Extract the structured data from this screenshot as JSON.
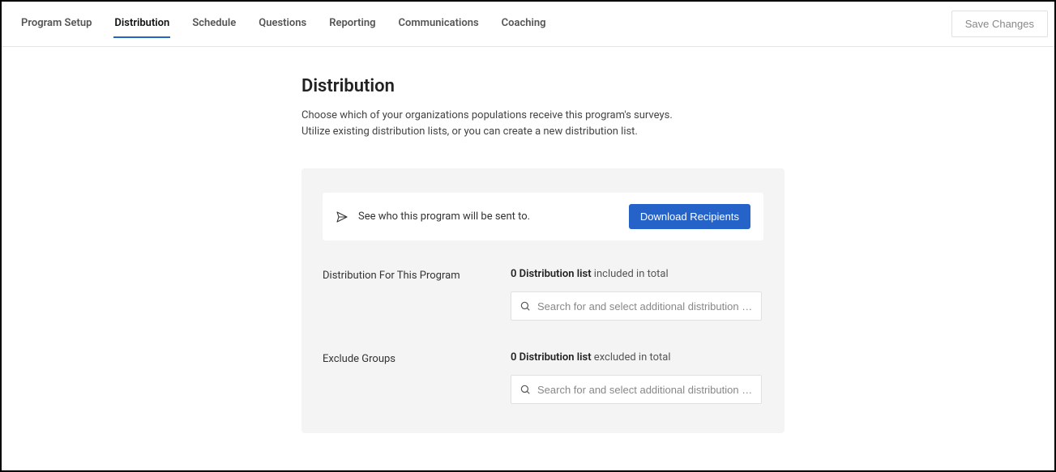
{
  "tabs": [
    {
      "label": "Program Setup",
      "active": false
    },
    {
      "label": "Distribution",
      "active": true
    },
    {
      "label": "Schedule",
      "active": false
    },
    {
      "label": "Questions",
      "active": false
    },
    {
      "label": "Reporting",
      "active": false
    },
    {
      "label": "Communications",
      "active": false
    },
    {
      "label": "Coaching",
      "active": false
    }
  ],
  "save_button_label": "Save Changes",
  "page": {
    "title": "Distribution",
    "description": "Choose which of your organizations populations receive this program's surveys. Utilize existing distribution lists, or you can create a new distribution list."
  },
  "info_card": {
    "text": "See who this program will be sent to.",
    "button_label": "Download Recipients"
  },
  "distribution": {
    "label": "Distribution For This Program",
    "count_prefix": "0 Distribution list",
    "count_suffix": " included in total",
    "search_placeholder": "Search for and select additional distribution gr..."
  },
  "exclude": {
    "label": "Exclude Groups",
    "count_prefix": "0 Distribution list",
    "count_suffix": " excluded in total",
    "search_placeholder": "Search for and select additional distribution gr..."
  }
}
